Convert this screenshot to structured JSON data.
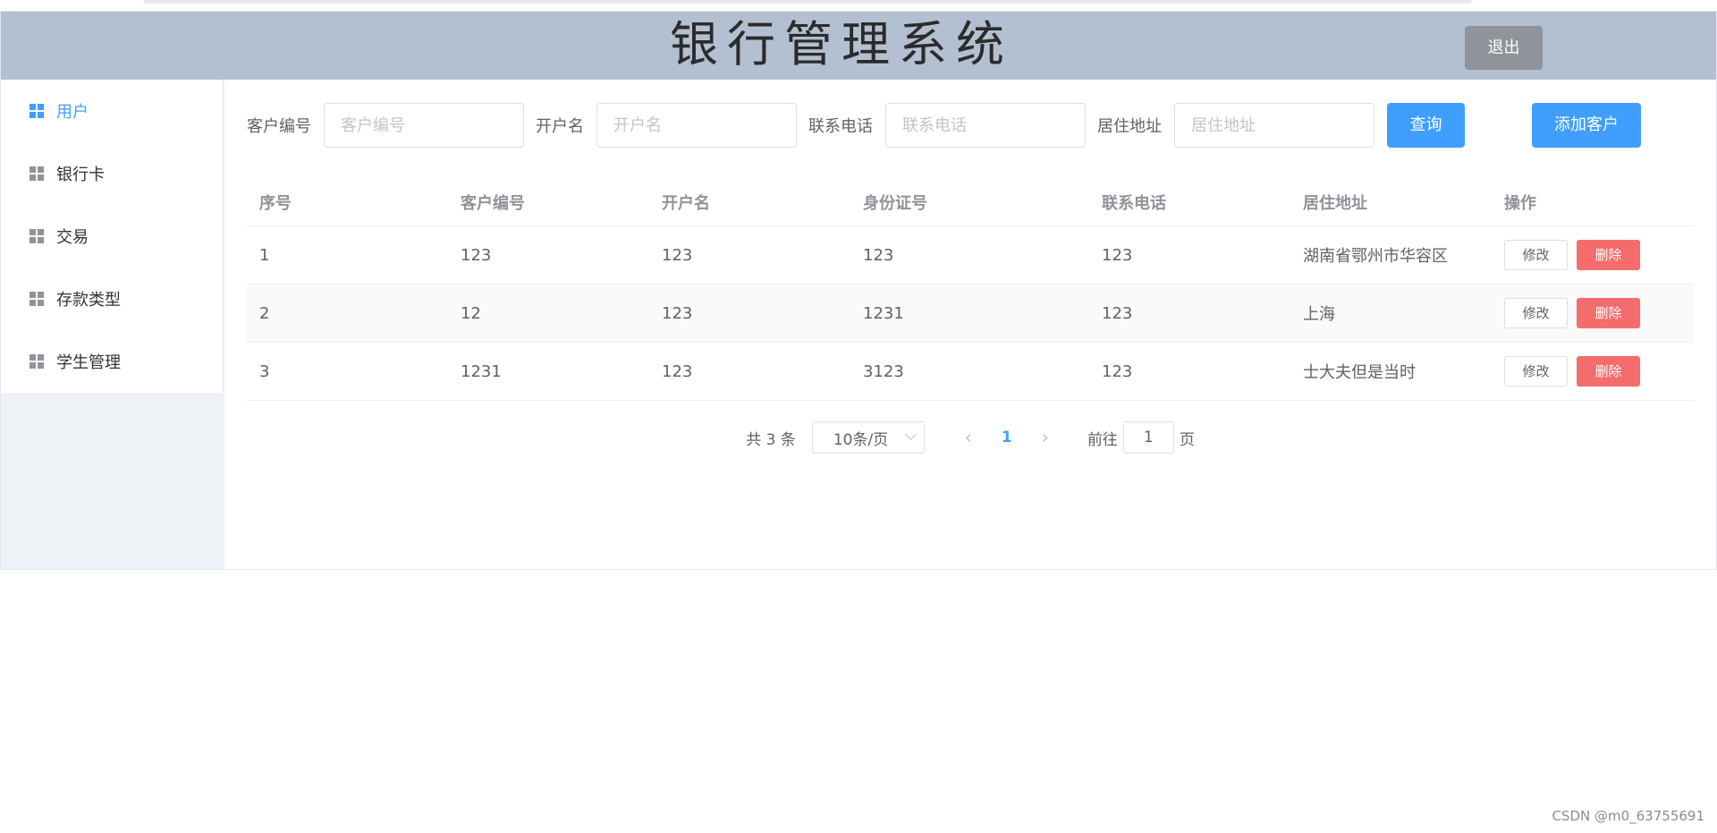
{
  "header": {
    "title": "银行管理系统",
    "logout_label": "退出"
  },
  "colors": {
    "header_bg": "#b3c0d1",
    "primary": "#409eff",
    "danger": "#f56c6c",
    "info": "#909399"
  },
  "sidebar": {
    "items": [
      {
        "label": "用户",
        "icon": "grid-icon",
        "active": true
      },
      {
        "label": "银行卡",
        "icon": "grid-icon"
      },
      {
        "label": "交易",
        "icon": "grid-icon"
      },
      {
        "label": "存款类型",
        "icon": "grid-icon"
      },
      {
        "label": "学生管理",
        "icon": "grid-icon"
      }
    ]
  },
  "search": {
    "customer_id_label": "客户编号",
    "customer_id_placeholder": "客户编号",
    "account_name_label": "开户名",
    "account_name_placeholder": "开户名",
    "phone_label": "联系电话",
    "phone_placeholder": "联系电话",
    "address_label": "居住地址",
    "address_placeholder": "居住地址",
    "query_label": "查询",
    "add_label": "添加客户"
  },
  "table": {
    "columns": [
      "序号",
      "客户编号",
      "开户名",
      "身份证号",
      "联系电话",
      "居住地址",
      "操作"
    ],
    "rows": [
      [
        "1",
        "123",
        "123",
        "123",
        "123",
        "湖南省鄂州市华容区"
      ],
      [
        "2",
        "12",
        "123",
        "1231",
        "123",
        "上海"
      ],
      [
        "3",
        "1231",
        "123",
        "3123",
        "123",
        "士大夫但是当时"
      ]
    ],
    "edit_label": "修改",
    "delete_label": "删除"
  },
  "pagination": {
    "total": "共 3 条",
    "page_size": "10条/页",
    "current_page": "1",
    "jump_prefix": "前往",
    "jump_value": "1",
    "jump_suffix": "页"
  },
  "watermark": "CSDN @m0_63755691"
}
